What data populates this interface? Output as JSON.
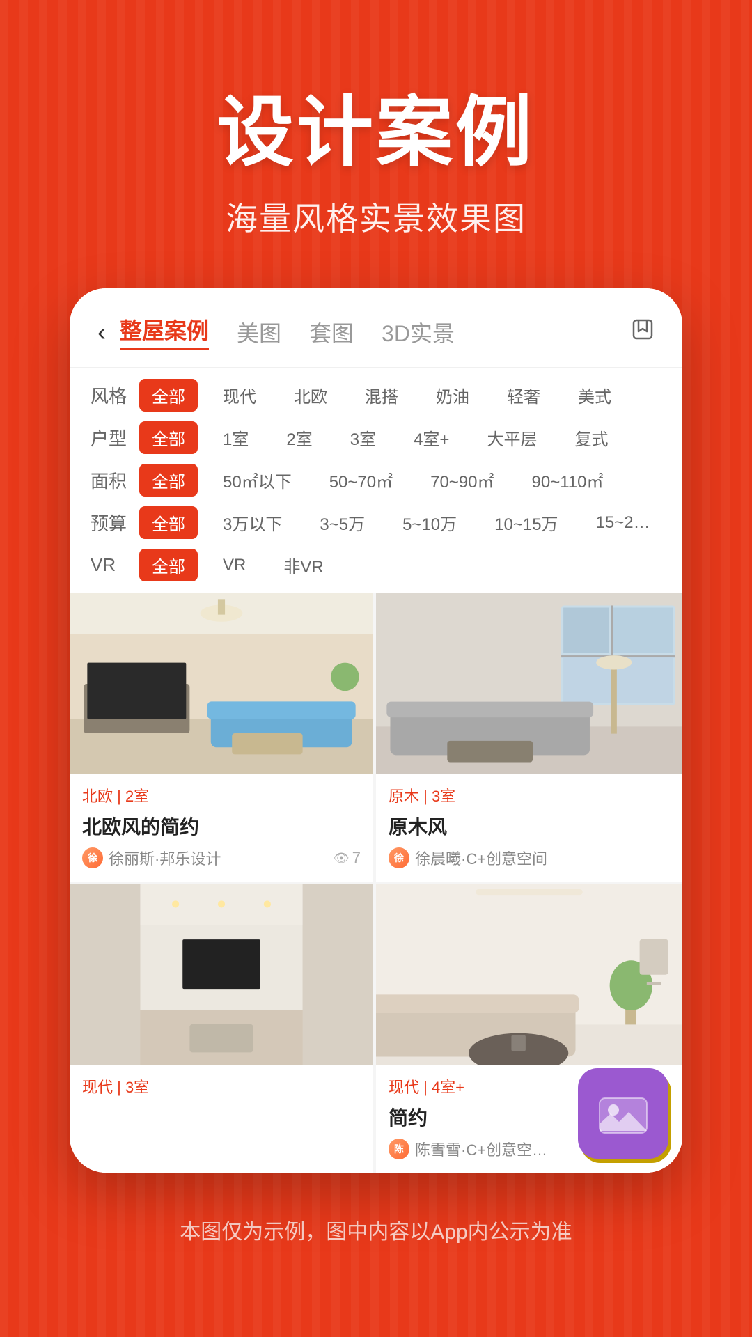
{
  "hero": {
    "title": "设计案例",
    "subtitle": "海量风格实景效果图"
  },
  "nav": {
    "back_icon": "‹",
    "tabs": [
      {
        "label": "整屋案例",
        "active": true
      },
      {
        "label": "美图",
        "active": false
      },
      {
        "label": "套图",
        "active": false
      },
      {
        "label": "3D实景",
        "active": false
      }
    ],
    "bookmark_icon": "⊡"
  },
  "filters": [
    {
      "label": "风格",
      "tags": [
        {
          "text": "全部",
          "active": true
        },
        {
          "text": "现代",
          "active": false
        },
        {
          "text": "北欧",
          "active": false
        },
        {
          "text": "混搭",
          "active": false
        },
        {
          "text": "奶油",
          "active": false
        },
        {
          "text": "轻奢",
          "active": false
        },
        {
          "text": "美式",
          "active": false
        }
      ]
    },
    {
      "label": "户型",
      "tags": [
        {
          "text": "全部",
          "active": true
        },
        {
          "text": "1室",
          "active": false
        },
        {
          "text": "2室",
          "active": false
        },
        {
          "text": "3室",
          "active": false
        },
        {
          "text": "4室+",
          "active": false
        },
        {
          "text": "大平层",
          "active": false
        },
        {
          "text": "复式",
          "active": false
        }
      ]
    },
    {
      "label": "面积",
      "tags": [
        {
          "text": "全部",
          "active": true
        },
        {
          "text": "50㎡以下",
          "active": false
        },
        {
          "text": "50~70㎡",
          "active": false
        },
        {
          "text": "70~90㎡",
          "active": false
        },
        {
          "text": "90~110㎡",
          "active": false
        }
      ]
    },
    {
      "label": "预算",
      "tags": [
        {
          "text": "全部",
          "active": true
        },
        {
          "text": "3万以下",
          "active": false
        },
        {
          "text": "3~5万",
          "active": false
        },
        {
          "text": "5~10万",
          "active": false
        },
        {
          "text": "10~15万",
          "active": false
        },
        {
          "text": "15~2…",
          "active": false
        }
      ]
    },
    {
      "label": "VR",
      "tags": [
        {
          "text": "全部",
          "active": true
        },
        {
          "text": "VR",
          "active": false
        },
        {
          "text": "非VR",
          "active": false
        }
      ]
    }
  ],
  "grid_items": [
    {
      "style_tag": "北欧 | 2室",
      "name": "北欧风的简约",
      "author": "徐丽斯·邦乐设计",
      "author_initial": "徐",
      "views": "7",
      "show_views": true,
      "position": "left-top"
    },
    {
      "style_tag": "原木 | 3室",
      "name": "原木风",
      "author": "徐晨曦·C+创意空间",
      "author_initial": "徐",
      "views": "",
      "show_views": false,
      "position": "right-top"
    },
    {
      "style_tag": "现代 | 3室",
      "name": "",
      "author": "",
      "author_initial": "",
      "views": "",
      "show_views": false,
      "position": "left-bottom"
    },
    {
      "style_tag": "现代 | 4室+",
      "name": "简约",
      "author": "陈雪雪·C+创意空…",
      "author_initial": "陈",
      "views": "",
      "show_views": false,
      "position": "right-bottom"
    }
  ],
  "footer": {
    "disclaimer": "本图仅为示例，图中内容以App内公示为准"
  }
}
